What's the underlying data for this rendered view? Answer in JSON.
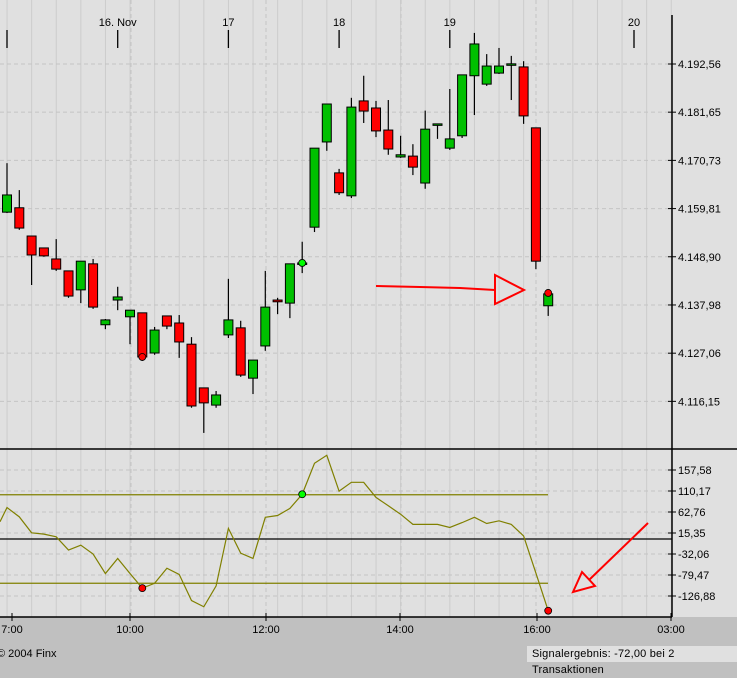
{
  "chart_data": [
    {
      "type": "candlestick",
      "colors": {
        "up": "#00c000",
        "down": "#ff0000",
        "background": "#e0e0e0",
        "signal_buy": "#00ff00",
        "signal_sell": "#ff0000"
      },
      "y_ticks": [
        "4.192,56",
        "4.181,65",
        "4.170,73",
        "4.159,81",
        "4.148,90",
        "4.137,98",
        "4.127,06",
        "4.116,15"
      ],
      "y_tick_values": [
        4192.56,
        4181.65,
        4170.73,
        4159.81,
        4148.9,
        4137.98,
        4127.06,
        4116.15
      ],
      "date_ticks": [
        {
          "label": "",
          "candle": 0
        },
        {
          "label": "16. Nov",
          "candle": 9
        },
        {
          "label": "17",
          "candle": 18
        },
        {
          "label": "18",
          "candle": 27
        },
        {
          "label": "19",
          "candle": 36
        },
        {
          "label": "20",
          "candle": 51
        }
      ],
      "grid": true,
      "candles": [
        [
          4159.0,
          4170.1,
          4158.8,
          4162.9
        ],
        [
          4160.0,
          4164.0,
          4155.0,
          4155.4
        ],
        [
          4153.6,
          4153.6,
          4142.5,
          4149.3
        ],
        [
          4150.9,
          4150.9,
          4148.9,
          4149.1
        ],
        [
          4148.4,
          4152.9,
          4145.7,
          4146.1
        ],
        [
          4145.7,
          4145.7,
          4139.6,
          4140.0
        ],
        [
          4141.4,
          4147.9,
          4138.4,
          4147.9
        ],
        [
          4147.3,
          4148.4,
          4137.1,
          4137.5
        ],
        [
          4133.5,
          4134.8,
          4132.5,
          4134.6
        ],
        [
          4139.1,
          4142.1,
          4136.8,
          4139.8
        ],
        [
          4135.3,
          4136.8,
          4129.1,
          4136.8
        ],
        [
          4136.2,
          4136.2,
          4125.3,
          4126.2
        ],
        [
          4127.1,
          4133.0,
          4126.7,
          4132.3
        ],
        [
          4135.5,
          4135.5,
          4132.5,
          4133.2
        ],
        [
          4133.9,
          4135.7,
          4126.0,
          4129.6
        ],
        [
          4129.1,
          4130.7,
          4114.7,
          4115.1
        ],
        [
          4119.2,
          4119.2,
          4109.0,
          4115.8
        ],
        [
          4115.3,
          4118.5,
          4114.7,
          4117.6
        ],
        [
          4131.2,
          4143.9,
          4130.5,
          4134.6
        ],
        [
          4132.8,
          4134.4,
          4121.7,
          4122.1
        ],
        [
          4121.4,
          4125.5,
          4117.8,
          4125.5
        ],
        [
          4128.7,
          4145.7,
          4127.6,
          4137.5
        ],
        [
          4139.1,
          4139.6,
          4135.9,
          4138.7
        ],
        [
          4138.4,
          4147.3,
          4135.0,
          4147.3
        ],
        [
          4147.5,
          4152.3,
          4145.2,
          4147.5
        ],
        [
          4155.6,
          4173.5,
          4154.5,
          4173.5
        ],
        [
          4174.9,
          4183.5,
          4172.9,
          4183.5
        ],
        [
          4167.9,
          4168.8,
          4162.9,
          4163.4
        ],
        [
          4162.7,
          4184.9,
          4162.2,
          4182.8
        ],
        [
          4184.2,
          4189.9,
          4179.2,
          4181.9
        ],
        [
          4182.6,
          4184.2,
          4176.0,
          4177.4
        ],
        [
          4177.6,
          4184.4,
          4172.0,
          4173.3
        ],
        [
          4171.5,
          4176.3,
          4171.3,
          4172.0
        ],
        [
          4171.7,
          4174.4,
          4167.4,
          4169.2
        ],
        [
          4165.6,
          4182.0,
          4164.3,
          4177.8
        ],
        [
          4179.0,
          4179.0,
          4175.6,
          4179.0
        ],
        [
          4173.5,
          4186.9,
          4173.1,
          4175.6
        ],
        [
          4176.3,
          4190.1,
          4175.8,
          4190.1
        ],
        [
          4189.9,
          4199.6,
          4181.0,
          4197.1
        ],
        [
          4188.0,
          4194.8,
          4187.6,
          4192.1
        ],
        [
          4190.5,
          4196.2,
          4190.3,
          4192.1
        ],
        [
          4192.6,
          4194.4,
          4184.4,
          4192.6
        ],
        [
          4191.9,
          4193.2,
          4179.0,
          4180.8
        ],
        [
          4178.1,
          4178.1,
          4146.1,
          4147.9
        ],
        [
          4137.8,
          4140.5,
          4135.5,
          4140.5
        ]
      ],
      "signals": [
        {
          "candle": 11,
          "type": "sell",
          "price": 4126.2
        },
        {
          "candle": 24,
          "type": "buy",
          "price": 4147.5
        },
        {
          "candle": 44,
          "type": "sell",
          "price": 4140.7
        }
      ]
    },
    {
      "type": "line",
      "color": "#808000",
      "y_ticks": [
        "157,58",
        "110,17",
        "62,76",
        "15,35",
        "-32,06",
        "-79,47",
        "-126,88"
      ],
      "y_tick_values": [
        157.58,
        110.17,
        62.76,
        15.35,
        -32.06,
        -79.47,
        -126.88
      ],
      "reference_lines": [
        100,
        0,
        -100
      ],
      "x_ticks": [
        "7:00",
        "10:00",
        "12:00",
        "14:00",
        "16:00",
        "03:00"
      ],
      "values": [
        71,
        50,
        14,
        11,
        5,
        -25,
        -14,
        -34,
        -78,
        -44,
        -78,
        -111,
        -100,
        -66,
        -80,
        -139,
        -153,
        -106,
        24,
        -32,
        -44,
        49,
        53,
        69,
        101,
        171,
        189,
        108,
        128,
        128,
        94,
        75,
        56,
        33,
        33,
        33,
        26,
        37,
        49,
        35,
        41,
        33,
        7,
        -77,
        -162
      ],
      "signals": [
        {
          "candle": 11,
          "type": "sell"
        },
        {
          "candle": 24,
          "type": "buy"
        },
        {
          "candle": 44,
          "type": "sell"
        }
      ]
    }
  ],
  "footer": {
    "copyright": "© 2004 Finx",
    "result": "Signalergebnis: -72,00 bei 2 Transaktionen"
  }
}
